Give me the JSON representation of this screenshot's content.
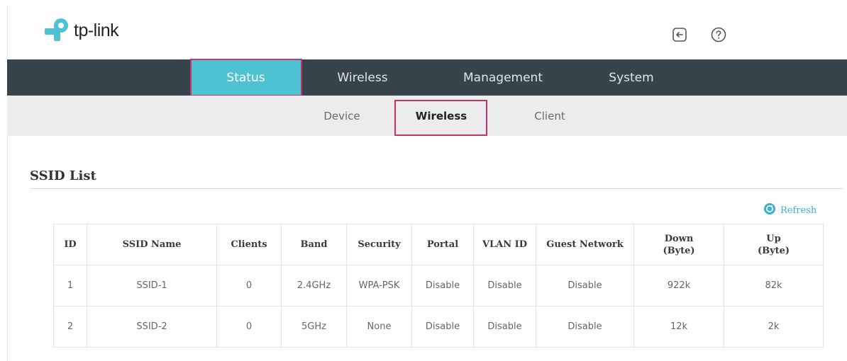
{
  "brand": {
    "name": "tp-link",
    "accent": "#4ec1d3",
    "dark_bar": "#37444c",
    "highlight": "#c7336b"
  },
  "header": {
    "icons": [
      "logout-icon",
      "help-icon"
    ]
  },
  "main_nav": {
    "tabs": [
      {
        "label": "Status",
        "active": true
      },
      {
        "label": "Wireless",
        "active": false
      },
      {
        "label": "Management",
        "active": false
      },
      {
        "label": "System",
        "active": false
      }
    ]
  },
  "sub_nav": {
    "tabs": [
      {
        "label": "Device",
        "active": false
      },
      {
        "label": "Wireless",
        "active": true
      },
      {
        "label": "Client",
        "active": false
      }
    ]
  },
  "section": {
    "title": "SSID List"
  },
  "refresh_label": "Refresh",
  "table": {
    "headers": [
      "ID",
      "SSID Name",
      "Clients",
      "Band",
      "Security",
      "Portal",
      "VLAN ID",
      "Guest Network",
      "Down\n(Byte)",
      "Up\n(Byte)"
    ],
    "rows": [
      [
        "1",
        "SSID-1",
        "0",
        "2.4GHz",
        "WPA-PSK",
        "Disable",
        "Disable",
        "Disable",
        "922k",
        "82k"
      ],
      [
        "2",
        "SSID-2",
        "0",
        "5GHz",
        "None",
        "Disable",
        "Disable",
        "Disable",
        "12k",
        "2k"
      ]
    ]
  }
}
